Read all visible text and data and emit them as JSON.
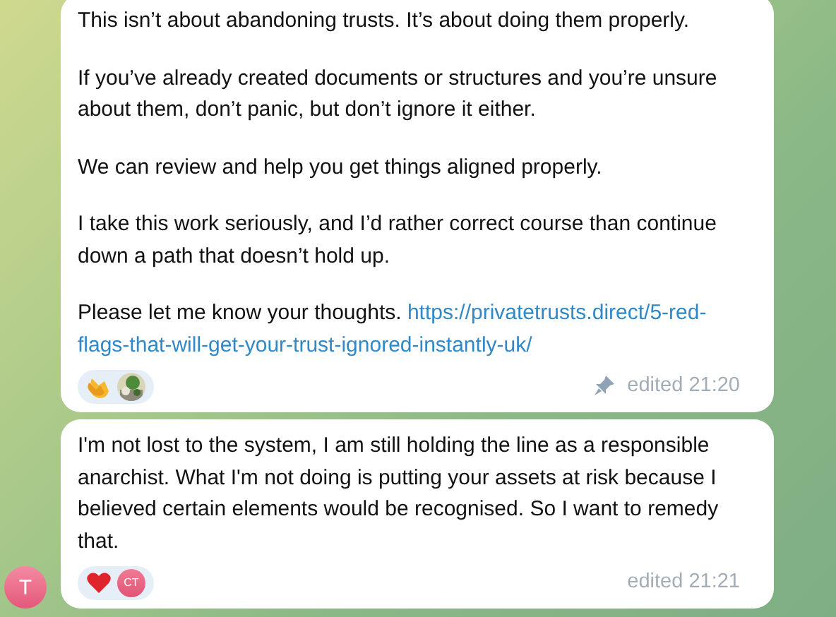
{
  "messages": [
    {
      "paragraphs": [
        {
          "text": "This isn’t about abandoning trusts. It’s about doing them properly."
        },
        {
          "text": "If you’ve already created documents or structures and you’re unsure about them, don’t panic, but don’t ignore it either."
        },
        {
          "text": "We can review and help you get things aligned properly."
        },
        {
          "text": "I take this work seriously, and I’d rather correct course than continue down a path that doesn’t hold up."
        },
        {
          "text": "Please let me know your thoughts.",
          "link": "https://privatetrusts.direct/5-red-flags-that-will-get-your-trust-ignored-instantly-uk/"
        }
      ],
      "reactions": [
        {
          "kind": "clap"
        },
        {
          "kind": "photo-avatar"
        }
      ],
      "pinned": true,
      "meta": "edited 21:20"
    },
    {
      "paragraphs": [
        {
          "text": "I'm not lost to the system, I am still holding the line as a responsible anarchist. What I'm not doing is putting your assets at risk because I believed certain elements would be recognised. So I want to remedy that."
        }
      ],
      "reactions": [
        {
          "kind": "heart"
        },
        {
          "kind": "initials-avatar",
          "initials": "CT"
        }
      ],
      "pinned": false,
      "meta": "edited 21:21",
      "sender_initial": "T"
    }
  ]
}
